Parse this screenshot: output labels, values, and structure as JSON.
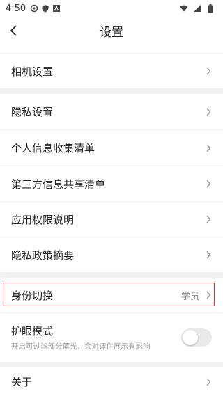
{
  "status_bar": {
    "time": "4:50",
    "icons": [
      "settings-icon",
      "shield-icon",
      "notification-a-icon"
    ],
    "right_icons": [
      "wifi-icon",
      "signal-icon",
      "battery-icon"
    ]
  },
  "header": {
    "back_icon": "chevron-left-icon",
    "title": "设置"
  },
  "rows": [
    {
      "label": "相机设置"
    },
    {
      "label": "隐私设置"
    },
    {
      "label": "个人信息收集清单"
    },
    {
      "label": "第三方信息共享清单"
    },
    {
      "label": "应用权限说明"
    },
    {
      "label": "隐私政策摘要"
    },
    {
      "label": "身份切换",
      "value": "学员"
    },
    {
      "label": "护眼模式",
      "subtitle": "开启可过滤部分蓝光，会对课件展示有影响",
      "toggle_on": false
    },
    {
      "label": "关于"
    }
  ],
  "colors": {
    "highlight_border": "#e3343a",
    "section_gap": "#f2f2f2",
    "subtitle_text": "#9a9a9a"
  }
}
